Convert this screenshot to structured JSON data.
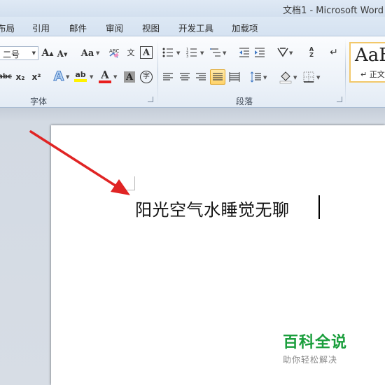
{
  "window": {
    "title": "文档1 - Microsoft Word"
  },
  "tabs": [
    "布局",
    "引用",
    "邮件",
    "审阅",
    "视图",
    "开发工具",
    "加载项"
  ],
  "font_group": {
    "size_value": "二号",
    "grow_font": "A",
    "shrink_font": "A",
    "change_case": "Aa",
    "clear_format": "ABC",
    "phonetic_guide": "文",
    "char_border": "A",
    "strikethrough": "abc",
    "subscript": "x₂",
    "superscript": "x²",
    "text_effects": "A",
    "highlight": "ab",
    "font_color": "A",
    "char_shading": "A",
    "enclose_char": "字",
    "label": "字体"
  },
  "paragraph_group": {
    "label": "段落",
    "sort": "A",
    "sort2": "Z"
  },
  "styles_group": {
    "preview": "AaB",
    "style_name": "↵ 正文"
  },
  "document": {
    "text": "阳光空气水睡觉无聊"
  },
  "watermark": {
    "title": "百科全说",
    "subtitle": "助你轻松解决"
  },
  "colors": {
    "ribbon_bg": "#eef3f9",
    "highlight_yellow": "#fff200",
    "font_red": "#e81e1e",
    "arrow_red": "#e02424",
    "brand_green": "#1a9e3c",
    "style_border": "#f2c86a"
  }
}
